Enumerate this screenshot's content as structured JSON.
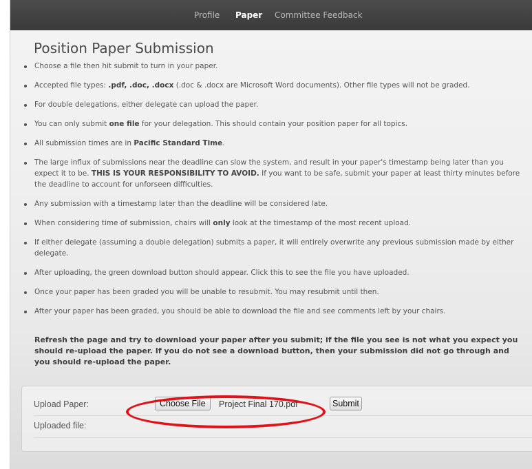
{
  "nav": {
    "items": [
      {
        "label": "Profile",
        "active": false
      },
      {
        "label": "Paper",
        "active": true
      },
      {
        "label": "Committee Feedback",
        "active": false
      }
    ]
  },
  "page": {
    "title": "Position Paper Submission"
  },
  "rules": [
    {
      "parts": [
        {
          "t": "Choose a file then hit submit to turn in your paper."
        }
      ]
    },
    {
      "parts": [
        {
          "t": "Accepted file types: "
        },
        {
          "t": ".pdf, .doc, .docx",
          "b": true
        },
        {
          "t": " (.doc & .docx are Microsoft Word documents). Other file types will not be graded."
        }
      ]
    },
    {
      "parts": [
        {
          "t": "For double delegations, either delegate can upload the paper."
        }
      ]
    },
    {
      "parts": [
        {
          "t": "You can only submit "
        },
        {
          "t": "one file",
          "b": true
        },
        {
          "t": " for your delegation. This should contain your position paper for all topics."
        }
      ]
    },
    {
      "parts": [
        {
          "t": "All submission times are in "
        },
        {
          "t": "Pacific Standard Time",
          "b": true
        },
        {
          "t": "."
        }
      ]
    },
    {
      "parts": [
        {
          "t": "The large influx of submissions near the deadline can slow the system, and result in your paper's timestamp being later than you expect it to be. "
        },
        {
          "t": "THIS IS YOUR RESPONSIBILITY TO AVOID.",
          "b": true
        },
        {
          "t": " If you want to be safe, submit your paper at least thirty minutes before the deadline to account for unforseen difficulties."
        }
      ]
    },
    {
      "parts": [
        {
          "t": "Any submission with a timestamp later than the deadline will be considered late."
        }
      ]
    },
    {
      "parts": [
        {
          "t": "When considering time of submission, chairs will "
        },
        {
          "t": "only",
          "b": true
        },
        {
          "t": " look at the timestamp of the most recent upload."
        }
      ]
    },
    {
      "parts": [
        {
          "t": "If either delegate (assuming a double delegation) submits a paper, it will entirely overwrite any previous submission made by either delegate."
        }
      ]
    },
    {
      "parts": [
        {
          "t": "After uploading, the green download button should appear. Click this to see the file you have uploaded."
        }
      ]
    },
    {
      "parts": [
        {
          "t": "Once your paper has been graded you will be unable to resubmit. You may resubmit until then."
        }
      ]
    },
    {
      "parts": [
        {
          "t": "After your paper has been graded, you should be able to download the file and see comments left by your chairs."
        }
      ]
    }
  ],
  "note": "Refresh the page and try to download your paper after you submit; if the file you see is not what you expect you should re-upload the paper. If you do not see a download button, then your submission did not go through and you should re-upload the paper.",
  "upload": {
    "label": "Upload Paper:",
    "choose_label": "Choose File",
    "file_name": "Project Final 170.pdf",
    "submit_label": "Submit",
    "uploaded_label": "Uploaded file:",
    "highlight_color": "#e0121a"
  }
}
